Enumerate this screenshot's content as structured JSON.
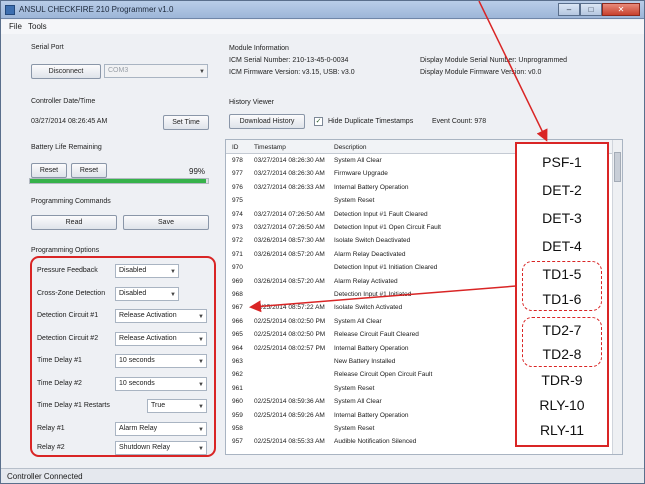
{
  "window": {
    "title": "ANSUL CHECKFIRE 210 Programmer v1.0"
  },
  "menu": {
    "file": "File",
    "tools": "Tools"
  },
  "serial_port": {
    "heading": "Serial Port",
    "disconnect_label": "Disconnect",
    "port_value": "COM3"
  },
  "controller_datetime": {
    "heading": "Controller Date/Time",
    "value": "03/27/2014 08:26:45 AM",
    "set_time_label": "Set Time"
  },
  "battery": {
    "heading": "Battery Life Remaining",
    "reset1_label": "Reset",
    "reset2_label": "Reset",
    "percent_text": "99%",
    "level": 0.99
  },
  "programming_commands": {
    "heading": "Programming Commands",
    "read_label": "Read",
    "save_label": "Save"
  },
  "programming_options": {
    "heading": "Programming Options",
    "rows": [
      {
        "label": "Pressure Feedback",
        "value": "Disabled"
      },
      {
        "label": "Cross-Zone Detection",
        "value": "Disabled"
      },
      {
        "label": "Detection Circuit #1",
        "value": "Release Activation"
      },
      {
        "label": "Detection Circuit #2",
        "value": "Release Activation"
      },
      {
        "label": "Time Delay #1",
        "value": "10 seconds"
      },
      {
        "label": "Time Delay #2",
        "value": "10 seconds"
      },
      {
        "label": "Time Delay #1 Restarts",
        "value": "True"
      },
      {
        "label": "Relay #1",
        "value": "Alarm Relay"
      },
      {
        "label": "Relay #2",
        "value": "Shutdown Relay"
      }
    ]
  },
  "module_info": {
    "heading": "Module Information",
    "icm_serial": "ICM Serial Number: 210-13-45-0-0034",
    "icm_firmware": "ICM Firmware Version: v3.15, USB: v3.0",
    "display_serial": "Display Module Serial Number: Unprogrammed",
    "display_firmware": "Display Module Firmware Version: v0.0"
  },
  "history": {
    "heading": "History Viewer",
    "download_label": "Download History",
    "hide_dup_label": "Hide Duplicate Timestamps",
    "hide_dup_checked": true,
    "event_count": "Event Count: 978",
    "columns": {
      "id": "ID",
      "timestamp": "Timestamp",
      "description": "Description"
    },
    "rows": [
      {
        "id": "978",
        "ts": "03/27/2014 08:26:30 AM",
        "desc": "System All Clear"
      },
      {
        "id": "977",
        "ts": "03/27/2014 08:26:30 AM",
        "desc": "Firmware Upgrade"
      },
      {
        "id": "976",
        "ts": "03/27/2014 08:26:33 AM",
        "desc": "Internal Battery Operation"
      },
      {
        "id": "975",
        "ts": "",
        "desc": "System Reset"
      },
      {
        "id": "974",
        "ts": "03/27/2014 07:26:50 AM",
        "desc": "Detection Input #1 Fault Cleared"
      },
      {
        "id": "973",
        "ts": "03/27/2014 07:26:50 AM",
        "desc": "Detection Input #1 Open Circuit Fault"
      },
      {
        "id": "972",
        "ts": "03/26/2014 08:57:30 AM",
        "desc": "Isolate Switch Deactivated"
      },
      {
        "id": "971",
        "ts": "03/26/2014 08:57:20 AM",
        "desc": "Alarm Relay Deactivated"
      },
      {
        "id": "970",
        "ts": "",
        "desc": "Detection Input #1 Initiation Cleared"
      },
      {
        "id": "969",
        "ts": "03/26/2014 08:57:20 AM",
        "desc": "Alarm Relay Activated"
      },
      {
        "id": "968",
        "ts": "",
        "desc": "Detection Input #1 Initiated"
      },
      {
        "id": "967",
        "ts": "02/25/2014 08:57:22 AM",
        "desc": "Isolate Switch Activated"
      },
      {
        "id": "966",
        "ts": "02/25/2014 08:02:50 PM",
        "desc": "System All Clear"
      },
      {
        "id": "965",
        "ts": "02/25/2014 08:02:50 PM",
        "desc": "Release Circuit Fault Cleared"
      },
      {
        "id": "964",
        "ts": "02/25/2014 08:02:57 PM",
        "desc": "Internal Battery Operation"
      },
      {
        "id": "963",
        "ts": "",
        "desc": "New Battery Installed"
      },
      {
        "id": "962",
        "ts": "",
        "desc": "Release Circuit Open Circuit Fault"
      },
      {
        "id": "961",
        "ts": "",
        "desc": "System Reset"
      },
      {
        "id": "960",
        "ts": "02/25/2014 08:59:36 AM",
        "desc": "System All Clear"
      },
      {
        "id": "959",
        "ts": "02/25/2014 08:59:26 AM",
        "desc": "Internal Battery Operation"
      },
      {
        "id": "958",
        "ts": "",
        "desc": "System Reset"
      },
      {
        "id": "957",
        "ts": "02/25/2014 08:55:33 AM",
        "desc": "Audible Notification Silenced"
      }
    ]
  },
  "annotation_codes": [
    "PSF-1",
    "DET-2",
    "DET-3",
    "DET-4",
    "TD1-5",
    "TD1-6",
    "TD2-7",
    "TD2-8",
    "TDR-9",
    "RLY-10",
    "RLY-11"
  ],
  "status": {
    "text": "Controller Connected"
  },
  "colors": {
    "annotation_red": "#d92525",
    "battery_green": "#36b24a",
    "title_blue": "#9db6d8"
  }
}
